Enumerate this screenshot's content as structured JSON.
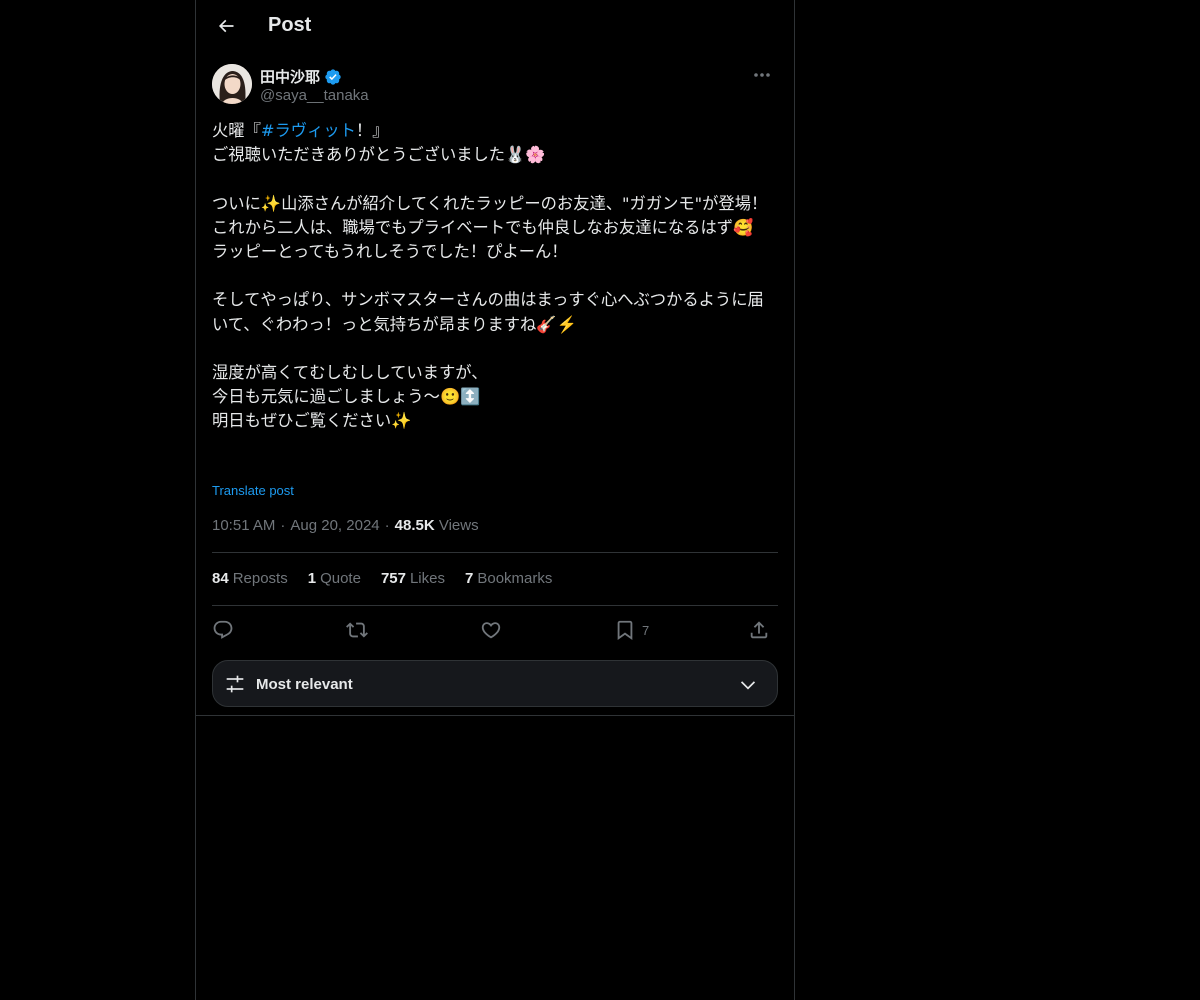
{
  "header": {
    "title": "Post"
  },
  "author": {
    "name": "田中沙耶",
    "handle": "@saya__tanaka"
  },
  "tweet": {
    "line1_prefix": "火曜『",
    "hashtag": "#ラヴィット",
    "line1_suffix": "！』",
    "body": "ご視聴いただきありがとうございました🐰🌸\n\nついに✨山添さんが紹介してくれたラッピーのお友達、\"ガガンモ\"が登場！\nこれから二人は、職場でもプライベートでも仲良しなお友達になるはず🥰\nラッピーとってもうれしそうでした！ぴよーん！\n\nそしてやっぱり、サンボマスターさんの曲はまっすぐ心へぶつかるように届いて、ぐわわっ！っと気持ちが昂まりますね🎸⚡️\n\n湿度が高くてむしむししていますが、\n今日も元気に過ごしましょう〜🙂↕️\n明日もぜひご覧ください✨",
    "translate": "Translate post"
  },
  "meta": {
    "time": "10:51 AM",
    "date": "Aug 20, 2024",
    "views_count": "48.5K",
    "views_label": "Views",
    "separator": "·"
  },
  "stats": {
    "reposts_count": "84",
    "reposts_label": "Reposts",
    "quotes_count": "1",
    "quotes_label": "Quote",
    "likes_count": "757",
    "likes_label": "Likes",
    "bookmarks_count": "7",
    "bookmarks_label": "Bookmarks"
  },
  "actions": {
    "bookmark_count": "7"
  },
  "sort": {
    "label": "Most relevant"
  },
  "colors": {
    "accent": "#1d9bf0",
    "background": "#000000",
    "border": "#2f3336",
    "muted": "#71767b"
  }
}
